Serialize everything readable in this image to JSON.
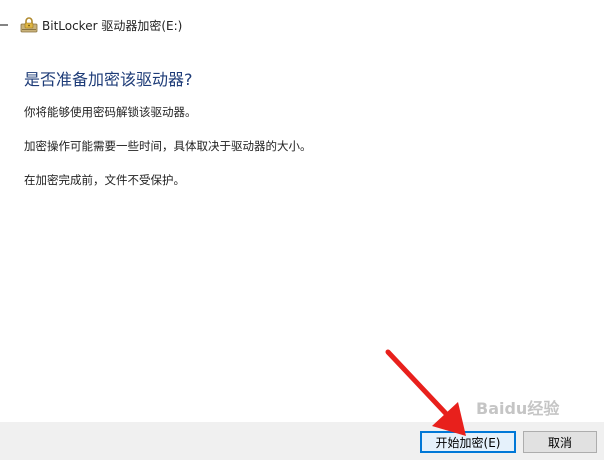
{
  "window": {
    "title": "BitLocker 驱动器加密(E:)",
    "icon": "bitlocker-drive-icon"
  },
  "content": {
    "heading": "是否准备加密该驱动器?",
    "paragraphs": [
      "你将能够使用密码解锁该驱动器。",
      "加密操作可能需要一些时间，具体取决于驱动器的大小。",
      "在加密完成前，文件不受保护。"
    ]
  },
  "footer": {
    "start_button": "开始加密(E)",
    "cancel_button": "取消"
  },
  "overlay": {
    "arrow_color": "#e8201c",
    "watermark": "Baidu经验"
  },
  "colors": {
    "heading": "#1e3c78",
    "footer_bg": "#f0f0f0",
    "focus_border": "#0078d7"
  }
}
